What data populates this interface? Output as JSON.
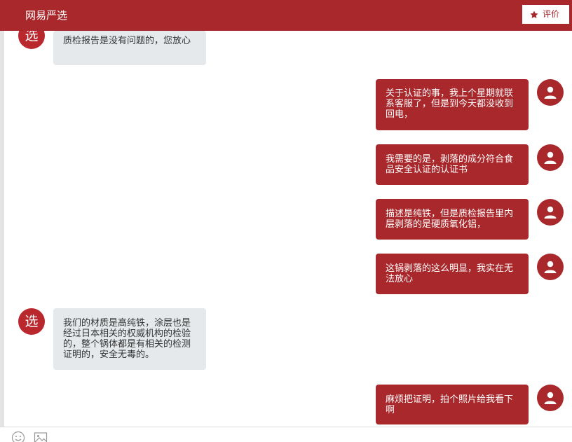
{
  "header": {
    "title": "网易严选",
    "rate_button_label": "评价"
  },
  "shop_avatar_glyph": "选",
  "messages": [
    {
      "from": "shop",
      "text": "质检报告是没有问题的，您放心"
    },
    {
      "from": "user",
      "text": "关于认证的事，我上个星期就联系客服了，但是到今天都没收到回电，"
    },
    {
      "from": "user",
      "text": "我需要的是，剥落的成分符合食品安全认证的认证书"
    },
    {
      "from": "user",
      "text": "描述是纯铁，但是质检报告里内层剥落的是硬质氧化铝，"
    },
    {
      "from": "user",
      "text": "这锅剥落的这么明显，我实在无法放心"
    },
    {
      "from": "shop",
      "text": "我们的材质是高纯铁，涂层也是经过日本相关的权威机构的检验的，整个锅体都是有相关的检测证明的，安全无毒的。"
    },
    {
      "from": "user",
      "text": "麻烦把证明，拍个照片给我看下啊"
    }
  ],
  "icons": {
    "rate": "star-icon",
    "user_avatar": "person-icon",
    "emoji": "smiley-icon",
    "image": "image-icon"
  },
  "colors": {
    "brand": "#a8282c",
    "shop_bubble": "#e5e9ec"
  }
}
